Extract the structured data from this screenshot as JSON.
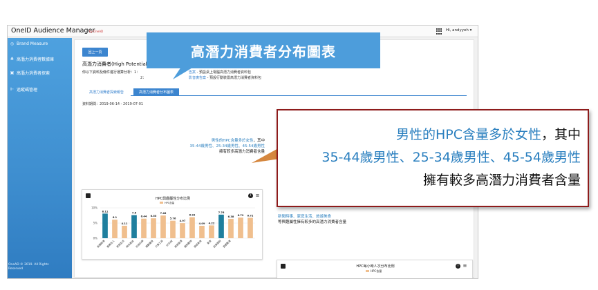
{
  "app": {
    "title": "OneID Audience Manager",
    "logo_text": "by OneAD",
    "user": "Hi, andyyeh ▾"
  },
  "sidebar": {
    "items": [
      {
        "label": "Brand Measure",
        "icon": "◎"
      },
      {
        "label": "高潛力消費者數據庫",
        "icon": "♣"
      },
      {
        "label": "高潛力消費者探索",
        "icon": "▣"
      },
      {
        "label": "追蹤碼管理",
        "icon": "⊩"
      }
    ],
    "footer": "OneAD © 2019. All Rights Reserved"
  },
  "main": {
    "back_label": "回上一頁",
    "page_title": "高潛力消費者(High Potential",
    "desc_line1": "你以下資料及條件進行運算分析：1：",
    "desc_line2": "2：",
    "package1_link": "告案",
    "package1_text": " - 預設桌上電腦高潛力消費者資料包",
    "package2_link": "影音廣告案",
    "package2_text": " - 預設行動裝置高潛力消費者資料包",
    "tabs": [
      {
        "label": "高潛力消費者探索報告"
      },
      {
        "label": "高潛力消費者分布圖表"
      }
    ],
    "date_range": "資料期間：2019-06-14 - 2019-07-01",
    "insight_small": {
      "line1_blue": "男性的HPC含量多於女性",
      "line1_black": "，其中",
      "line2_blue": "35-44歲男性、25-34歲男性、45-54歲男性",
      "line3": "擁有較多高潛力消費者含量"
    },
    "right_text": {
      "line1": "新聞時事、家庭生活、旅遊美食",
      "line2": "等興趣屬性擁有較多的高潛力消費者含量"
    },
    "card2": {
      "title": "HPC每小時人次分布比例",
      "legend": "HPC含量"
    }
  },
  "overlay": {
    "banner": "高潛力消費者分布圖表",
    "callout": {
      "line1_blue": "男性的HPC含量多於女性",
      "line1_black": "，其中",
      "line2": "35-44歲男性、25-34歲男性、45-54歲男性",
      "line3": "擁有較多高潛力消費者含量"
    }
  },
  "colors": {
    "accent": "#3c85cf",
    "sidebar": "#3f8fd0",
    "bar_normal": "#f0bf8e",
    "bar_highlight": "#1f7f9e",
    "callout_border": "#8e1b1b",
    "banner": "#4d9ddb"
  },
  "chart_data": {
    "type": "bar",
    "title": "HPC興趣屬性分布比例",
    "legend": [
      "HPC含量"
    ],
    "ytick_labels": [
      "10%",
      "5%",
      "0%"
    ],
    "ylim": [
      0,
      10
    ],
    "categories": [
      "新聞時事",
      "娛樂名人",
      "家庭生活",
      "時尚美妝",
      "科技科學",
      "運動健身",
      "汽車工具",
      "3C科技",
      "居家裝潢",
      "寵物動物",
      "旅遊美食",
      "美食",
      "投資理財",
      "遊戲動漫"
    ],
    "values": [
      8.11,
      6.1,
      4.11,
      7.6,
      6.44,
      6.55,
      7.48,
      5.76,
      4.97,
      6.92,
      4.09,
      4.22,
      7.76,
      6.38
    ],
    "data_labels": [
      "8.11",
      "6.1",
      "4.11",
      "7.6",
      "6.44",
      "6.55",
      "7.48",
      "5.76",
      "4.97",
      "6.92",
      "4.09",
      "4.22",
      "7.76",
      "6.38"
    ],
    "highlighted": [
      0,
      3,
      12
    ],
    "extra_labels": [
      "6.79",
      "6.72"
    ],
    "extra_values": [
      6.79,
      6.72
    ],
    "grid": true
  }
}
